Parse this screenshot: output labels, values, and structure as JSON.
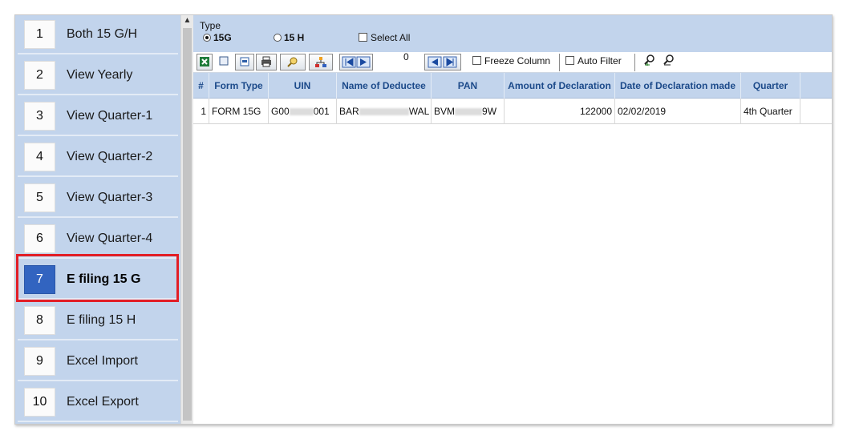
{
  "sidebar": {
    "items": [
      {
        "num": "1",
        "label": "Both 15 G/H"
      },
      {
        "num": "2",
        "label": "View Yearly"
      },
      {
        "num": "3",
        "label": "View Quarter-1"
      },
      {
        "num": "4",
        "label": "View Quarter-2"
      },
      {
        "num": "5",
        "label": "View Quarter-3"
      },
      {
        "num": "6",
        "label": "View Quarter-4"
      },
      {
        "num": "7",
        "label": "E filing 15 G"
      },
      {
        "num": "8",
        "label": "E filing 15 H"
      },
      {
        "num": "9",
        "label": "Excel Import"
      },
      {
        "num": "10",
        "label": "Excel Export"
      }
    ],
    "active_index": 6
  },
  "type_filter": {
    "title": "Type",
    "options": [
      "15G",
      "15 H"
    ],
    "selected": "15G",
    "select_all_label": "Select All"
  },
  "toolbar": {
    "page_value": "0",
    "freeze_column_label": "Freeze Column",
    "auto_filter_label": "Auto Filter",
    "icons": [
      "excel-export-icon",
      "export-icon",
      "print-icon",
      "search-icon",
      "hierarchy-icon",
      "first-page-icon",
      "previous-page-icon",
      "next-page-icon",
      "last-page-icon",
      "zoom-in-icon",
      "zoom-out-icon"
    ]
  },
  "grid": {
    "columns": [
      "#",
      "Form Type",
      "UIN",
      "Name of Deductee",
      "PAN",
      "Amount of Declaration",
      "Date of Declaration made",
      "Quarter"
    ],
    "rows": [
      [
        "1",
        "FORM 15G",
        "G00",
        "001",
        "BAR",
        "WAL",
        "BVM",
        "9W",
        "122000",
        "02/02/2019",
        "4th Quarter"
      ]
    ]
  },
  "colors": {
    "panel_bg": "#c2d4ec",
    "active_number_bg": "#3264c0",
    "highlight_border": "#e21e26",
    "header_text": "#1c4a8a"
  }
}
